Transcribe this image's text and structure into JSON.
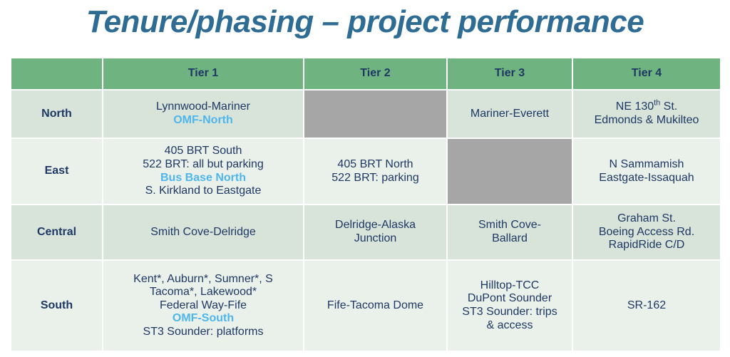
{
  "slide": {
    "title": "Tenure/phasing – project performance"
  },
  "colors": {
    "title": "#2E6C94",
    "header_green": "#6FB381",
    "row_dark": "#D8E4DA",
    "row_light": "#EAF0EA",
    "blocked_gray": "#A6A6A6",
    "accent_blue": "#4FB6EC",
    "body_text": "#1F3864"
  },
  "table": {
    "corner_label": "",
    "columns": [
      "Tier 1",
      "Tier 2",
      "Tier 3",
      "Tier 4"
    ],
    "rows": [
      {
        "label": "North",
        "cells": [
          {
            "blocked": false,
            "lines": [
              {
                "text": "Lynnwood-Mariner",
                "accent": false
              },
              {
                "text": "OMF-North",
                "accent": true
              }
            ]
          },
          {
            "blocked": true,
            "lines": []
          },
          {
            "blocked": false,
            "lines": [
              {
                "text": "Mariner-Everett",
                "accent": false
              }
            ]
          },
          {
            "blocked": false,
            "lines": [
              {
                "text": "NE 130th St.",
                "accent": false,
                "superscript": "th",
                "prefix": "NE 130",
                "suffix": " St."
              },
              {
                "text": "Edmonds & Mukilteo",
                "accent": false
              }
            ]
          }
        ]
      },
      {
        "label": "East",
        "cells": [
          {
            "blocked": false,
            "lines": [
              {
                "text": "405 BRT South",
                "accent": false
              },
              {
                "text": "522 BRT: all but parking",
                "accent": false
              },
              {
                "text": "Bus Base North",
                "accent": true
              },
              {
                "text": "S. Kirkland to Eastgate",
                "accent": false
              }
            ]
          },
          {
            "blocked": false,
            "lines": [
              {
                "text": "405 BRT North",
                "accent": false
              },
              {
                "text": "522 BRT: parking",
                "accent": false
              }
            ]
          },
          {
            "blocked": true,
            "lines": []
          },
          {
            "blocked": false,
            "lines": [
              {
                "text": "N Sammamish",
                "accent": false
              },
              {
                "text": "Eastgate-Issaquah",
                "accent": false
              }
            ]
          }
        ]
      },
      {
        "label": "Central",
        "cells": [
          {
            "blocked": false,
            "lines": [
              {
                "text": "Smith Cove-Delridge",
                "accent": false
              }
            ]
          },
          {
            "blocked": false,
            "lines": [
              {
                "text": "Delridge-Alaska",
                "accent": false
              },
              {
                "text": "Junction",
                "accent": false
              }
            ]
          },
          {
            "blocked": false,
            "lines": [
              {
                "text": "Smith Cove-",
                "accent": false
              },
              {
                "text": "Ballard",
                "accent": false
              }
            ]
          },
          {
            "blocked": false,
            "lines": [
              {
                "text": "Graham St.",
                "accent": false
              },
              {
                "text": "Boeing Access Rd.",
                "accent": false
              },
              {
                "text": "RapidRide C/D",
                "accent": false
              }
            ]
          }
        ]
      },
      {
        "label": "South",
        "cells": [
          {
            "blocked": false,
            "lines": [
              {
                "text": "Kent*, Auburn*, Sumner*, S",
                "accent": false
              },
              {
                "text": "Tacoma*, Lakewood*",
                "accent": false
              },
              {
                "text": "Federal Way-Fife",
                "accent": false
              },
              {
                "text": "OMF-South",
                "accent": true
              },
              {
                "text": "ST3 Sounder: platforms",
                "accent": false
              }
            ]
          },
          {
            "blocked": false,
            "lines": [
              {
                "text": "Fife-Tacoma Dome",
                "accent": false
              }
            ]
          },
          {
            "blocked": false,
            "lines": [
              {
                "text": "Hilltop-TCC",
                "accent": false
              },
              {
                "text": "DuPont Sounder",
                "accent": false
              },
              {
                "text": "ST3 Sounder: trips",
                "accent": false
              },
              {
                "text": "& access",
                "accent": false
              }
            ]
          },
          {
            "blocked": false,
            "lines": [
              {
                "text": "SR-162",
                "accent": false
              }
            ]
          }
        ]
      }
    ]
  }
}
